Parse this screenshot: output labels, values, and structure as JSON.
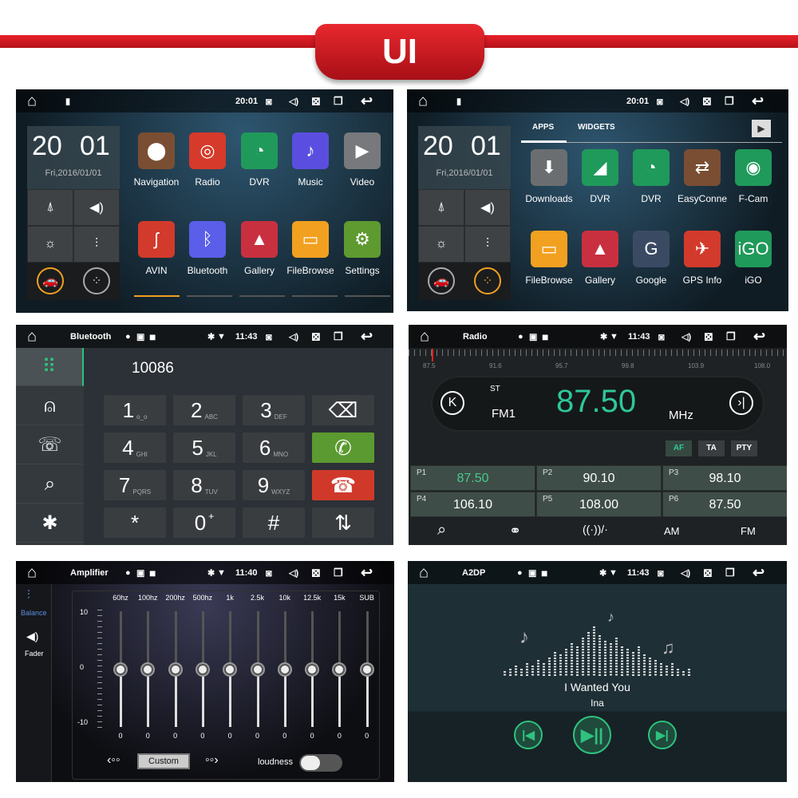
{
  "banner": {
    "title": "UI"
  },
  "home1": {
    "status": {
      "time": "20:01"
    },
    "clock": {
      "hours": "20",
      "minutes": "01",
      "date": "Fri,2016/01/01"
    },
    "apps": [
      {
        "label": "Navigation",
        "color": "#7a4e32",
        "glyph": "⬤"
      },
      {
        "label": "Radio",
        "color": "#d63a2a",
        "glyph": "◎"
      },
      {
        "label": "DVR",
        "color": "#1f9a5a",
        "glyph": "◔"
      },
      {
        "label": "Music",
        "color": "#5a4ee0",
        "glyph": "♪"
      },
      {
        "label": "Video",
        "color": "#77797c",
        "glyph": "▶"
      },
      {
        "label": "AVIN",
        "color": "#d23a2c",
        "glyph": "ʃ"
      },
      {
        "label": "Bluetooth",
        "color": "#5a5ee8",
        "glyph": "ᛒ"
      },
      {
        "label": "Gallery",
        "color": "#c8303f",
        "glyph": "▲"
      },
      {
        "label": "FileBrowse",
        "color": "#f2a020",
        "glyph": "▭"
      },
      {
        "label": "Settings",
        "color": "#5e9a30",
        "glyph": "⚙"
      }
    ]
  },
  "home2": {
    "status": {
      "time": "20:01"
    },
    "clock": {
      "hours": "20",
      "minutes": "01",
      "date": "Fri,2016/01/01"
    },
    "tabs": [
      "APPS",
      "WIDGETS"
    ],
    "apps": [
      {
        "label": "Downloads",
        "color": "#6b6e70",
        "glyph": "⬇"
      },
      {
        "label": "DVR",
        "color": "#1f9a5a",
        "glyph": "◢"
      },
      {
        "label": "DVR",
        "color": "#1f9a5a",
        "glyph": "◔"
      },
      {
        "label": "EasyConne",
        "color": "#7a4e32",
        "glyph": "⇄"
      },
      {
        "label": "F-Cam",
        "color": "#1f9a5a",
        "glyph": "◉"
      },
      {
        "label": "FileBrowse",
        "color": "#f2a020",
        "glyph": "▭"
      },
      {
        "label": "Gallery",
        "color": "#c8303f",
        "glyph": "▲"
      },
      {
        "label": "Google",
        "color": "#3b4a63",
        "glyph": "G"
      },
      {
        "label": "GPS Info",
        "color": "#d23a2c",
        "glyph": "✈"
      },
      {
        "label": "iGO",
        "color": "#1f9a5a",
        "glyph": "iGO"
      }
    ]
  },
  "bluetooth": {
    "status": {
      "title": "Bluetooth",
      "time": "11:43"
    },
    "number": "10086",
    "keys": [
      {
        "d": "1",
        "l": "o_o"
      },
      {
        "d": "2",
        "l": "ABC"
      },
      {
        "d": "3",
        "l": "DEF"
      },
      {
        "d": "⌫",
        "l": ""
      },
      {
        "d": "4",
        "l": "GHI"
      },
      {
        "d": "5",
        "l": "JKL"
      },
      {
        "d": "6",
        "l": "MNO"
      },
      {
        "d": "✆",
        "l": ""
      },
      {
        "d": "7",
        "l": "PQRS"
      },
      {
        "d": "8",
        "l": "TUV"
      },
      {
        "d": "9",
        "l": "WXYZ"
      },
      {
        "d": "☎",
        "l": ""
      },
      {
        "d": "*",
        "l": ""
      },
      {
        "d": "0",
        "l": "+"
      },
      {
        "d": "#",
        "l": ""
      },
      {
        "d": "⇅",
        "l": ""
      }
    ],
    "colors": {
      "call": "#5b9a30",
      "hangup": "#d0392a",
      "accent": "#2ec27e"
    }
  },
  "radio": {
    "status": {
      "title": "Radio",
      "time": "11:43"
    },
    "scale": [
      "87.5",
      "91.6",
      "95.7",
      "99.8",
      "103.9",
      "108.0"
    ],
    "st": "ST",
    "band": "FM1",
    "freq": "87.50",
    "unit": "MHz",
    "flags": [
      "AF",
      "TA",
      "PTY"
    ],
    "presets": [
      {
        "n": "P1",
        "v": "87.50"
      },
      {
        "n": "P2",
        "v": "90.10"
      },
      {
        "n": "P3",
        "v": "98.10"
      },
      {
        "n": "P4",
        "v": "106.10"
      },
      {
        "n": "P5",
        "v": "108.00"
      },
      {
        "n": "P6",
        "v": "87.50"
      }
    ],
    "bottom": [
      "AM",
      "FM"
    ],
    "accent": "#2ec79a"
  },
  "amp": {
    "status": {
      "title": "Amplifier",
      "time": "11:40"
    },
    "side": [
      "Balance",
      "Fader"
    ],
    "scale": [
      "10",
      "0",
      "-10"
    ],
    "bands": [
      {
        "f": "60hz",
        "v": 0
      },
      {
        "f": "100hz",
        "v": 0
      },
      {
        "f": "200hz",
        "v": 0
      },
      {
        "f": "500hz",
        "v": 0
      },
      {
        "f": "1k",
        "v": 0
      },
      {
        "f": "2.5k",
        "v": 0
      },
      {
        "f": "10k",
        "v": 0
      },
      {
        "f": "12.5k",
        "v": 0
      },
      {
        "f": "15k",
        "v": 0
      },
      {
        "f": "SUB",
        "v": 0
      }
    ],
    "preset": "Custom",
    "loudness": "loudness",
    "loudness_on": false
  },
  "a2dp": {
    "status": {
      "title": "A2DP",
      "time": "11:43"
    },
    "song": "I Wanted You",
    "artist": "Ina",
    "accent": "#2ec27e"
  }
}
